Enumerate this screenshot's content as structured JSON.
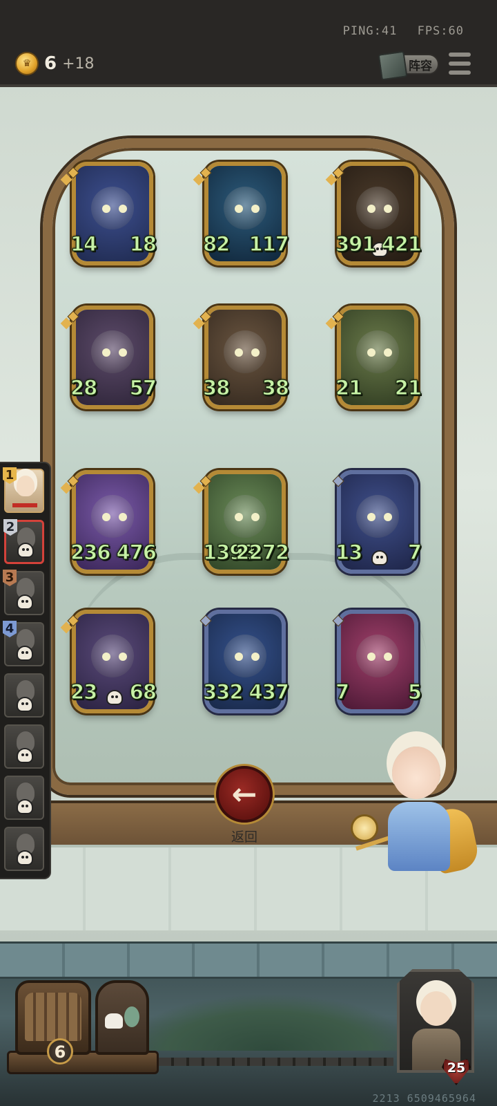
{
  "topbar": {
    "ping_label": "PING:41",
    "fps_label": "FPS:60",
    "gold_count": "6",
    "gold_income": "+18",
    "lineup_label": "阵容",
    "coin_icon": "coin-crown-icon",
    "menu_icon": "hamburger-menu-icon"
  },
  "board": {
    "cards": [
      {
        "atk": "14",
        "hp": "18",
        "tier": "gold",
        "palette": [
          "#3d4f8f",
          "#1f2a4f"
        ]
      },
      {
        "atk": "82",
        "hp": "117",
        "tier": "gold",
        "palette": [
          "#2c5a7a",
          "#10263a"
        ]
      },
      {
        "atk": "391",
        "hp": "421",
        "tier": "gold",
        "palette": [
          "#4a3a2a",
          "#231a12"
        ],
        "skull": true
      },
      {
        "atk": "28",
        "hp": "57",
        "tier": "gold",
        "palette": [
          "#5d4b6a",
          "#2d2438"
        ]
      },
      {
        "atk": "38",
        "hp": "38",
        "tier": "gold",
        "palette": [
          "#6a5540",
          "#33281e"
        ]
      },
      {
        "atk": "21",
        "hp": "21",
        "tier": "gold",
        "palette": [
          "#6a7a4a",
          "#2e3a20"
        ]
      },
      {
        "atk": "236",
        "hp": "476",
        "tier": "gold",
        "palette": [
          "#7a5aa8",
          "#3a2658"
        ]
      },
      {
        "atk": "1393",
        "hp": "2272",
        "tier": "gold",
        "palette": [
          "#6a8a58",
          "#2f4426"
        ]
      },
      {
        "atk": "13",
        "hp": "7",
        "tier": "blue",
        "palette": [
          "#3f4f8a",
          "#1e2548"
        ],
        "skull": true
      },
      {
        "atk": "23",
        "hp": "68",
        "tier": "gold",
        "palette": [
          "#5a4a7a",
          "#2a2240"
        ],
        "skull": true
      },
      {
        "atk": "332",
        "hp": "437",
        "tier": "blue",
        "palette": [
          "#34508a",
          "#182848"
        ]
      },
      {
        "atk": "7",
        "hp": "5",
        "tier": "blue",
        "palette": [
          "#a0406a",
          "#4a1834"
        ]
      }
    ]
  },
  "lineup": {
    "slots": [
      {
        "rank": "1",
        "style": "gold"
      },
      {
        "rank": "2",
        "style": "silver"
      },
      {
        "rank": "3",
        "style": "bronze"
      },
      {
        "rank": "4",
        "style": "blue"
      },
      {
        "rank": "",
        "style": ""
      },
      {
        "rank": "",
        "style": ""
      },
      {
        "rank": "",
        "style": ""
      },
      {
        "rank": "",
        "style": ""
      }
    ]
  },
  "back_button": {
    "icon": "arrow-left-icon",
    "label": "返回"
  },
  "shop": {
    "level": "6"
  },
  "player": {
    "hp": "25"
  },
  "session_id": "2213 6509465964",
  "colors": {
    "stat_green": "#c7f2a6",
    "hp_red": "#a9443a",
    "atk_blue": "#4a5fa6",
    "frame_gold": "#b58a36"
  }
}
